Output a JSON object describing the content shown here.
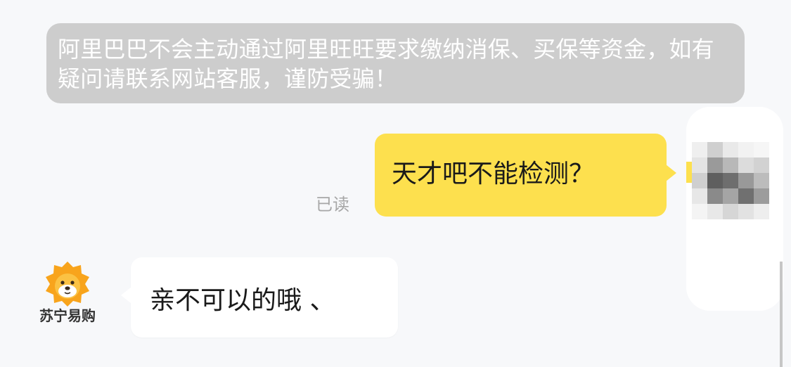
{
  "chat": {
    "system_notice": "阿里巴巴不会主动通过阿里旺旺要求缴纳消保、买保等资金，如有疑问请联系网站客服，谨防受骗！",
    "read_status": "已读",
    "messages": [
      {
        "sender": "me",
        "text": "天才吧不能检测？"
      },
      {
        "sender": "shop",
        "text": "亲不可以的哦 、"
      }
    ]
  },
  "shop": {
    "name": "苏宁易购",
    "avatar_icon": "suning-lion-logo-icon"
  },
  "self": {
    "avatar_icon": "pixelated-avatar-icon"
  },
  "colors": {
    "background": "#f7f8fa",
    "notice_bg": "#cdcdcd",
    "my_bubble": "#fde04e",
    "their_bubble": "#ffffff",
    "brand_orange": "#f8a41c"
  }
}
